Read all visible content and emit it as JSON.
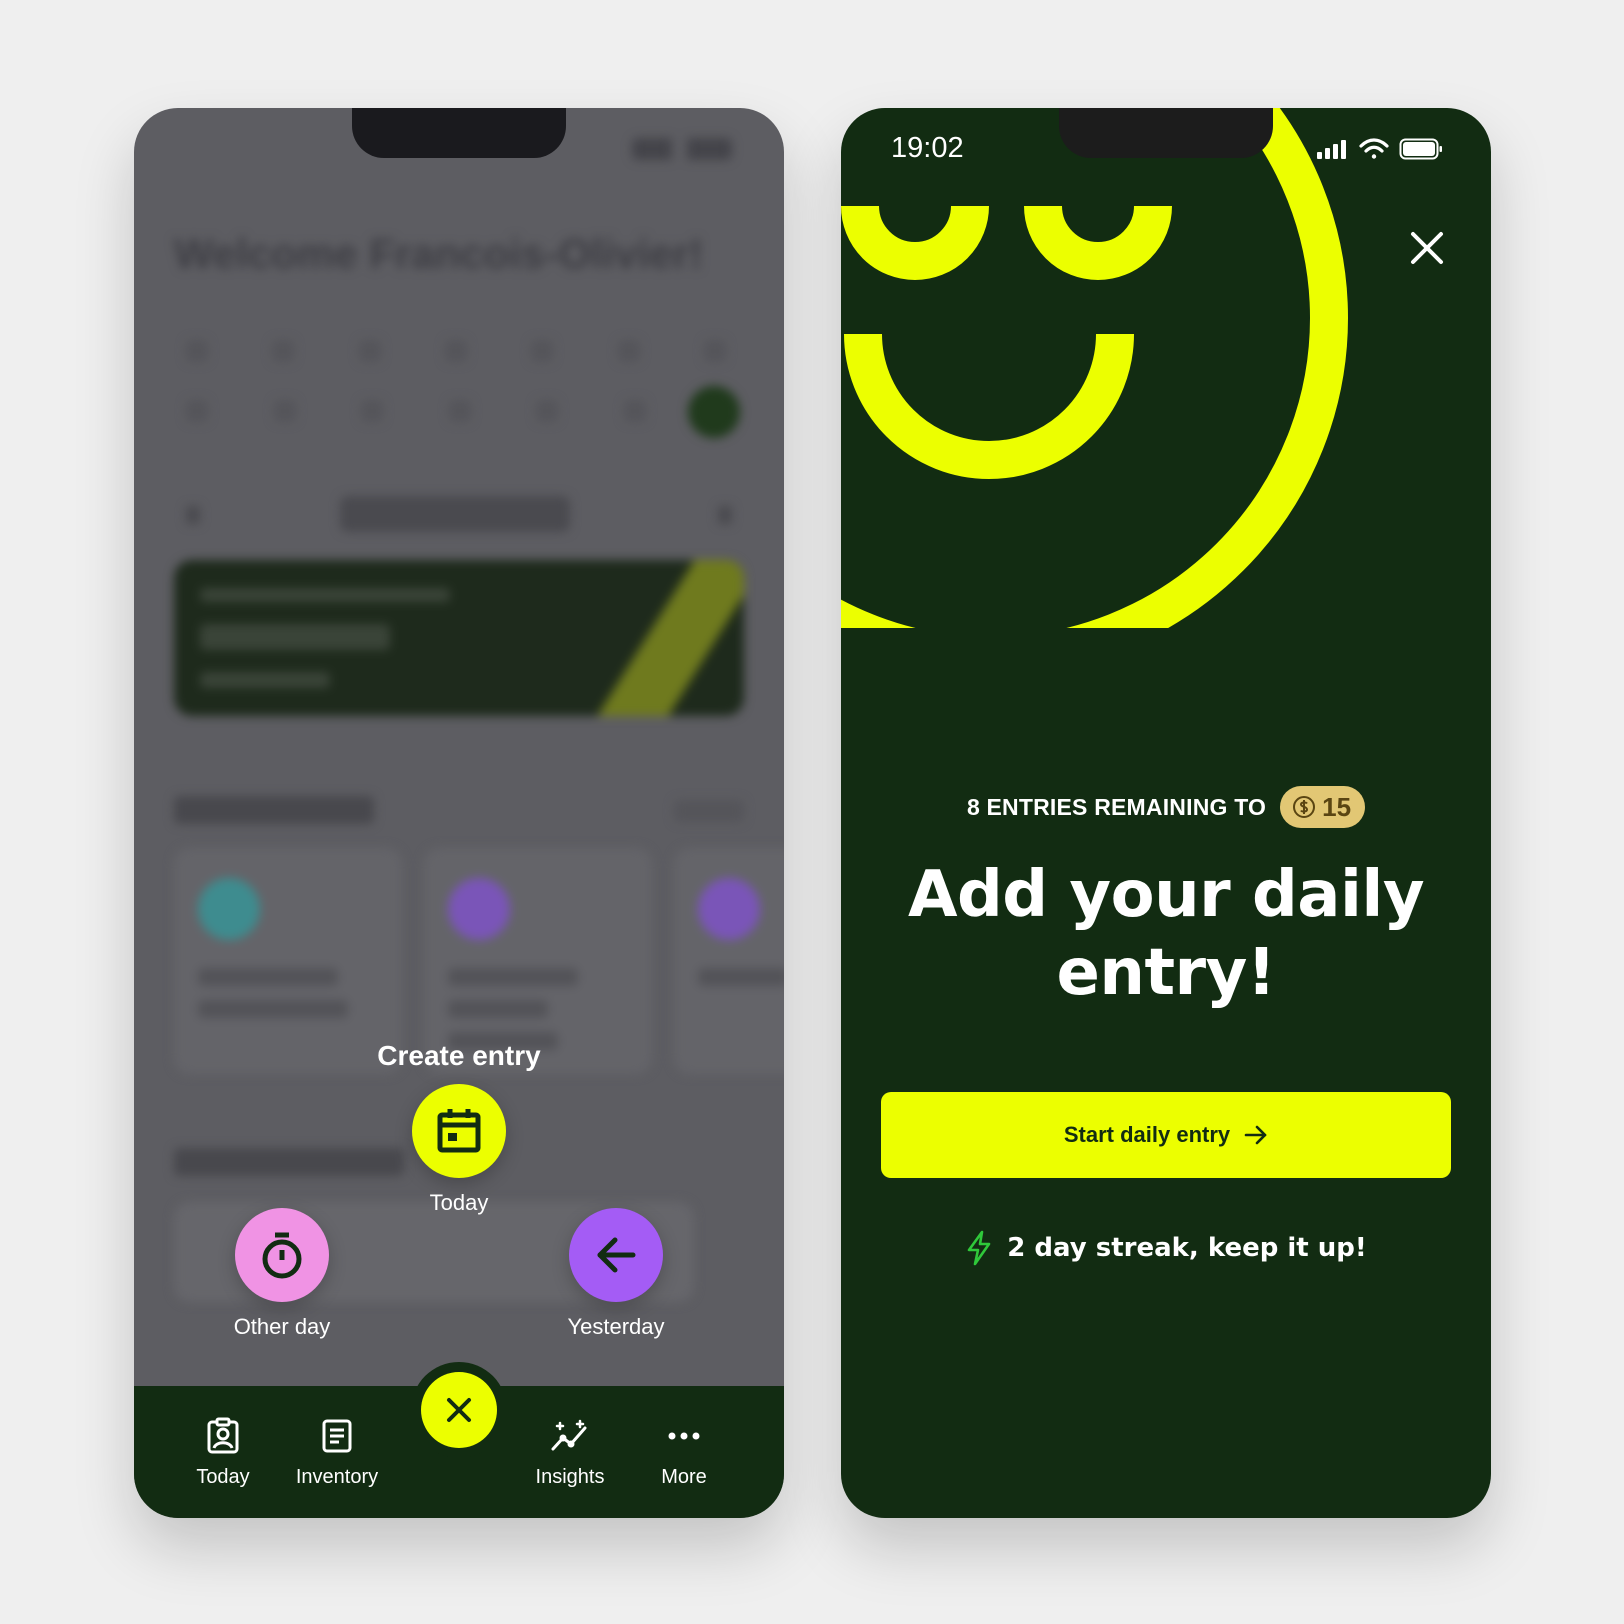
{
  "left": {
    "background": {
      "welcome": "Welcome Francois-Olivier!"
    },
    "menu": {
      "title": "Create entry",
      "options": [
        {
          "label": "Today",
          "color": "#ecff00",
          "icon": "calendar-icon"
        },
        {
          "label": "Other day",
          "color": "#f093e4",
          "icon": "stopwatch-icon"
        },
        {
          "label": "Yesterday",
          "color": "#a45cf5",
          "icon": "arrow-left-icon"
        }
      ]
    },
    "tabbar": {
      "items": [
        {
          "label": "Today",
          "icon": "clipboard-user-icon"
        },
        {
          "label": "Inventory",
          "icon": "document-list-icon"
        },
        {
          "label": "Insights",
          "icon": "sparkle-chart-icon"
        },
        {
          "label": "More",
          "icon": "ellipsis-icon"
        }
      ],
      "center_icon": "close-icon"
    }
  },
  "right": {
    "status": {
      "time": "19:02"
    },
    "entries_remaining": "8 ENTRIES REMAINING TO",
    "coin_value": "15",
    "headline_line1": "Add your daily",
    "headline_line2": "entry!",
    "cta_label": "Start daily entry",
    "streak_text": "2 day streak, keep it up!"
  },
  "colors": {
    "dark_green": "#122c12",
    "accent_yellow": "#ecff00",
    "pink": "#f093e4",
    "purple": "#a45cf5",
    "gold": "#e2c774",
    "streak_green": "#2fc83a"
  }
}
